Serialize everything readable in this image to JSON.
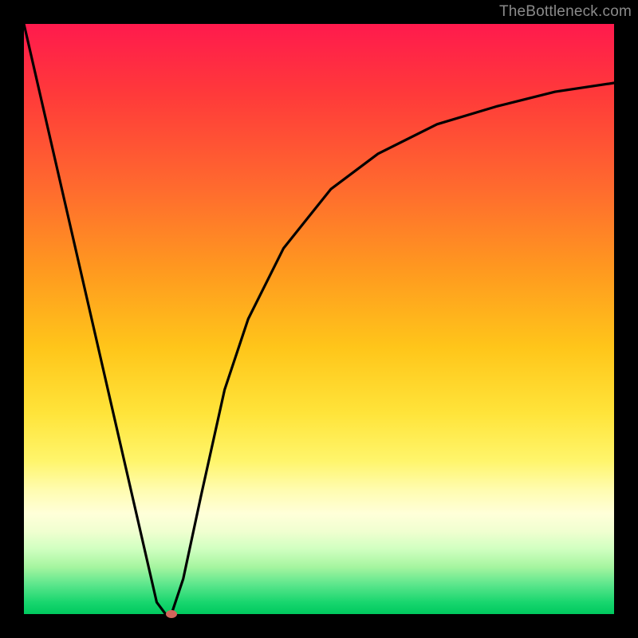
{
  "watermark": "TheBottleneck.com",
  "chart_data": {
    "type": "line",
    "title": "",
    "xlabel": "",
    "ylabel": "",
    "xlim": [
      0,
      100
    ],
    "ylim": [
      0,
      100
    ],
    "grid": false,
    "series": [
      {
        "name": "curve",
        "x": [
          0,
          22.5,
          24,
          25,
          27,
          30,
          34,
          38,
          44,
          52,
          60,
          70,
          80,
          90,
          100
        ],
        "y": [
          100,
          2,
          0,
          0,
          6,
          20,
          38,
          50,
          62,
          72,
          78,
          83,
          86,
          88.5,
          90
        ]
      }
    ],
    "marker": {
      "x": 25,
      "y": 0
    },
    "background": "red-yellow-green vertical gradient",
    "colors": {
      "curve": "#000000",
      "marker": "#d1655b",
      "frame_border": "#000000"
    }
  }
}
